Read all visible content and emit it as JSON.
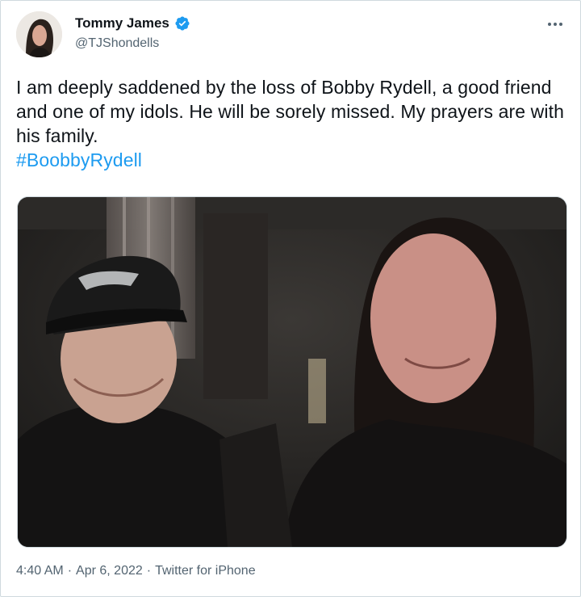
{
  "author": {
    "name": "Tommy James",
    "handle": "@TJShondells",
    "verified": true
  },
  "tweet": {
    "text": "I am deeply saddened by the loss of Bobby Rydell, a good friend and one of my idols. He will be sorely missed. My prayers are with his family.",
    "hashtag": "#BoobbyRydell"
  },
  "meta": {
    "time": "4:40 AM",
    "separator1": "·",
    "date": "Apr 6, 2022",
    "separator2": "·",
    "source": "Twitter for iPhone"
  },
  "icons": {
    "verified": "verified-badge-icon",
    "more": "more-options-icon"
  },
  "colors": {
    "accent": "#1d9bf0",
    "secondary_text": "#536471",
    "primary_text": "#0f1419",
    "border": "#cfd9de"
  }
}
